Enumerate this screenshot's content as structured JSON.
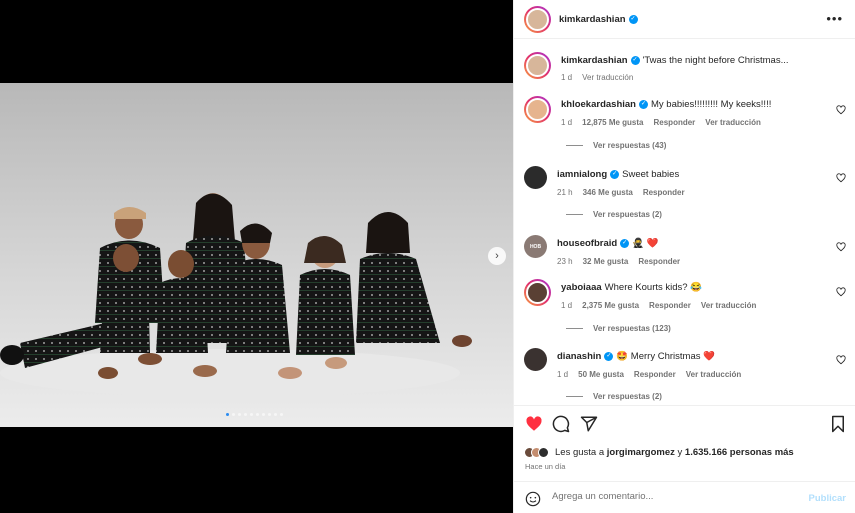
{
  "post": {
    "username": "kimkardashian",
    "more_icon": "more-horizontal-icon"
  },
  "media": {
    "next_icon": "chevron-right-icon",
    "dots_count": 10,
    "active_dot": 0
  },
  "caption": {
    "username": "kimkardashian",
    "text": "'Twas the night before Christmas...",
    "time": "1 d",
    "translate": "Ver traducción"
  },
  "comments": [
    {
      "username": "khloekardashian",
      "verified": true,
      "text": "My babies!!!!!!!!! My keeks!!!!",
      "time": "1 d",
      "likes": "12,875 Me gusta",
      "reply": "Responder",
      "translate": "Ver traducción",
      "replies": "Ver respuestas (43)"
    },
    {
      "username": "iamnialong",
      "verified": true,
      "text": "Sweet babies",
      "time": "21 h",
      "likes": "346 Me gusta",
      "reply": "Responder",
      "translate": "",
      "replies": "Ver respuestas (2)"
    },
    {
      "username": "houseofbraid",
      "verified": true,
      "text": "🥷 ❤️",
      "time": "23 h",
      "likes": "32 Me gusta",
      "reply": "Responder",
      "translate": "",
      "replies": ""
    },
    {
      "username": "yaboiaaa",
      "verified": false,
      "text": "Where Kourts kids? 😂",
      "time": "1 d",
      "likes": "2,375 Me gusta",
      "reply": "Responder",
      "translate": "Ver traducción",
      "replies": "Ver respuestas (123)"
    },
    {
      "username": "dianashin",
      "verified": true,
      "text": "🤩 Merry Christmas ❤️",
      "time": "1 d",
      "likes": "50 Me gusta",
      "reply": "Responder",
      "translate": "Ver traducción",
      "replies": "Ver respuestas (2)"
    }
  ],
  "actions": {
    "like_icon": "heart-filled-icon",
    "comment_icon": "comment-icon",
    "share_icon": "share-icon",
    "save_icon": "bookmark-icon",
    "likes_prefix": "Les gusta a",
    "likes_user": "jorgimargomez",
    "likes_connector": "y",
    "likes_count": "1.635.166 personas más",
    "ago": "Hace un día"
  },
  "add_comment": {
    "placeholder": "Agrega un comentario...",
    "publish": "Publicar",
    "emoji_icon": "emoji-icon"
  },
  "colors": {
    "like_red": "#ff3040",
    "link_blue": "#0095f6",
    "publish_disabled": "#b2dffc",
    "muted": "#737373"
  }
}
